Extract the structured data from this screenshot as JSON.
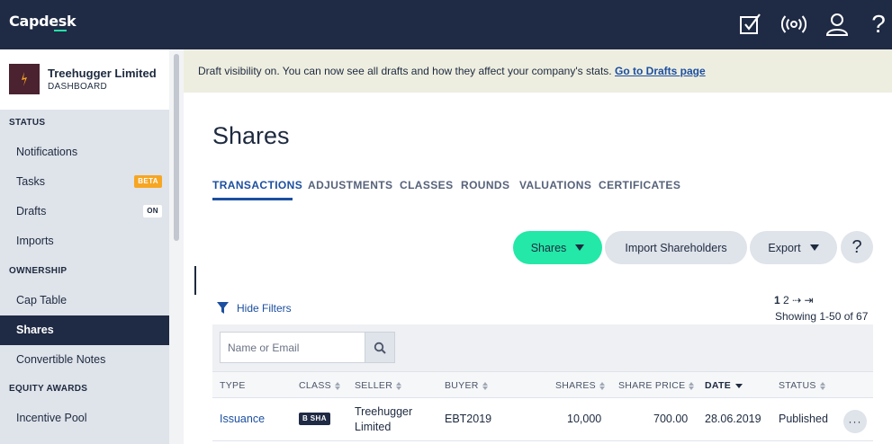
{
  "app": {
    "logo": "Capdesk"
  },
  "topbar": {
    "icons": [
      "tasks-check-icon",
      "broadcast-icon",
      "user-icon",
      "help-icon"
    ],
    "help_glyph": "?"
  },
  "company": {
    "name": "Treehugger Limited",
    "subtitle": "DASHBOARD"
  },
  "sidebar": {
    "sections": [
      {
        "label": "STATUS"
      },
      {
        "label": "OWNERSHIP"
      },
      {
        "label": "EQUITY AWARDS"
      }
    ],
    "items": [
      {
        "label": "Notifications"
      },
      {
        "label": "Tasks",
        "badge": "BETA"
      },
      {
        "label": "Drafts",
        "badge": "ON"
      },
      {
        "label": "Imports"
      },
      {
        "label": "Cap Table"
      },
      {
        "label": "Shares",
        "active": true
      },
      {
        "label": "Convertible Notes"
      },
      {
        "label": "Incentive Pool"
      }
    ]
  },
  "banner": {
    "text": "Draft visibility on. You can now see all drafts and how they affect your company's stats.",
    "link": "Go to Drafts page"
  },
  "page": {
    "title": "Shares"
  },
  "tabs": [
    {
      "label": "TRANSACTIONS",
      "active": true
    },
    {
      "label": "ADJUSTMENTS"
    },
    {
      "label": "CLASSES"
    },
    {
      "label": "ROUNDS"
    },
    {
      "label": "VALUATIONS"
    },
    {
      "label": "CERTIFICATES"
    }
  ],
  "actions": {
    "shares_dropdown": "Shares",
    "import": "Import Shareholders",
    "export": "Export",
    "help": "?"
  },
  "filters": {
    "toggle_label": "Hide Filters",
    "search_placeholder": "Name or Email"
  },
  "pagination": {
    "current": "1",
    "next_page": "2",
    "next_arrow": "⇢",
    "last_arrow": "⇥",
    "showing": "Showing 1-50 of 67"
  },
  "table": {
    "columns": [
      "TYPE",
      "CLASS",
      "SELLER",
      "BUYER",
      "SHARES",
      "SHARE PRICE",
      "DATE",
      "STATUS"
    ],
    "rows": [
      {
        "type": "Issuance",
        "class": "B SHA",
        "seller_line1": "Treehugger",
        "seller_line2": "Limited",
        "buyer": "EBT2019",
        "shares": "10,000",
        "share_price": "700.00",
        "date": "28.06.2019",
        "status": "Published",
        "more": "···"
      }
    ]
  },
  "colors": {
    "topbar": "#1f2a44",
    "accent_green": "#23e8a8",
    "link_blue": "#1c4fa0",
    "banner_bg": "#eeeee0",
    "sidebar_bg": "#dfe3ea",
    "badge_beta": "#f6a623"
  }
}
